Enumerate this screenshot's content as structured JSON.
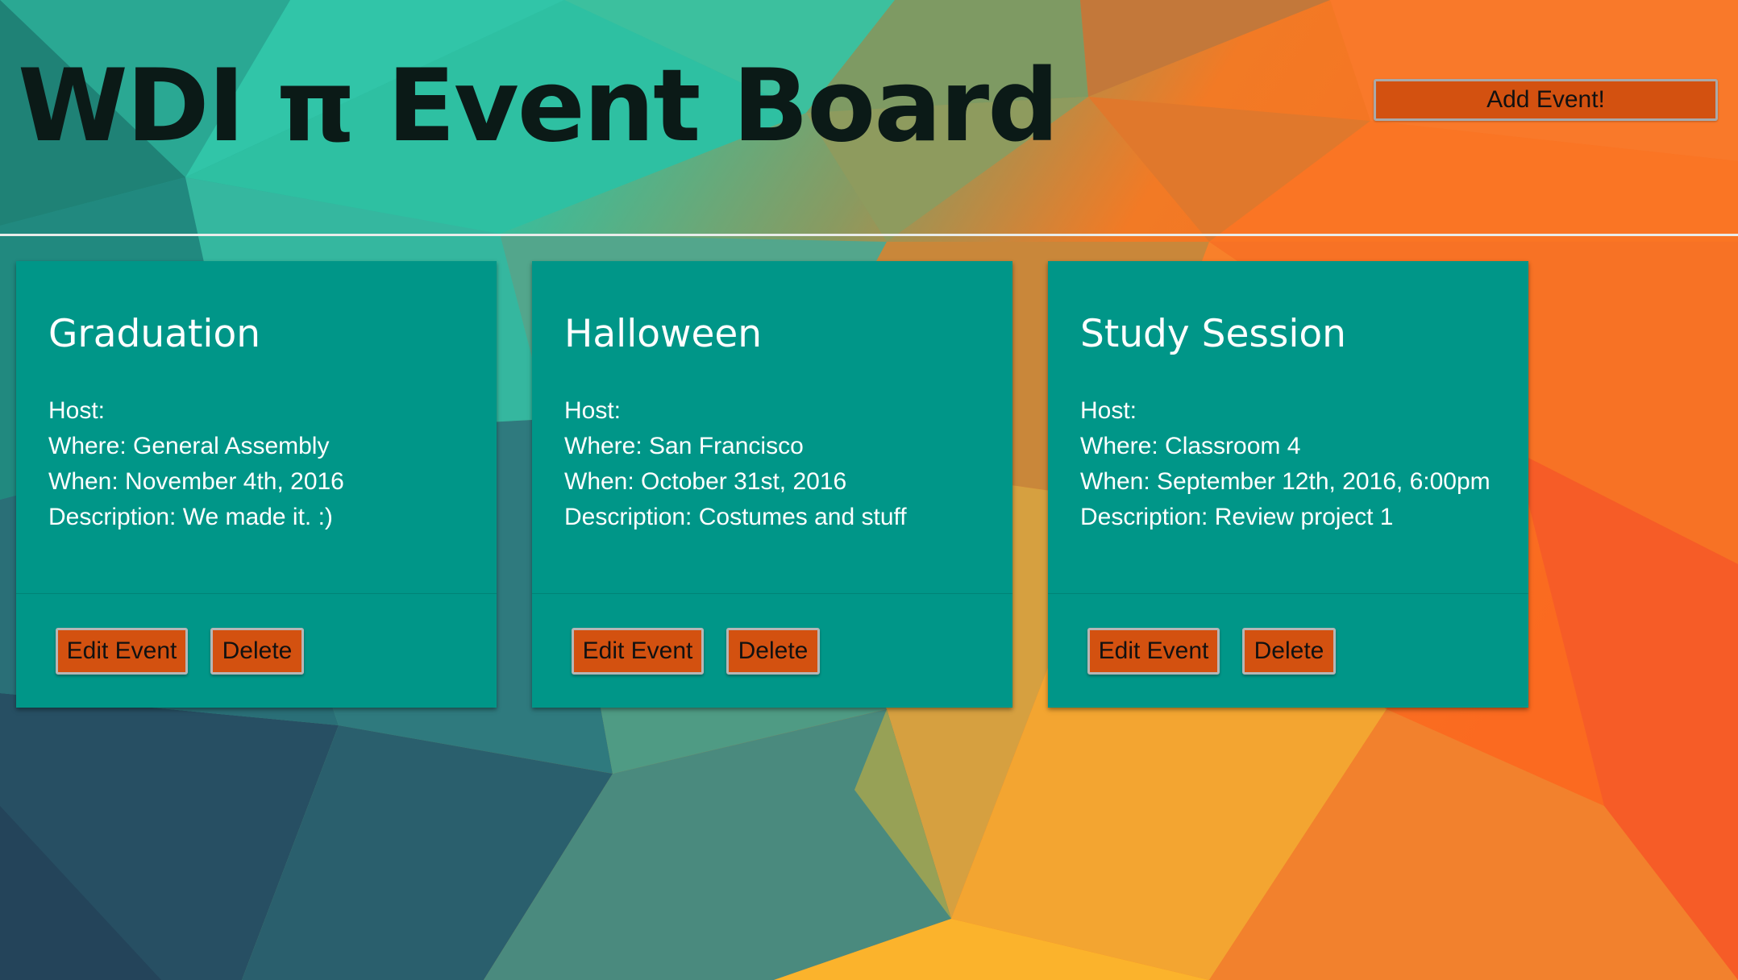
{
  "header": {
    "title": "WDI π Event Board",
    "add_button_label": "Add Event!"
  },
  "events": [
    {
      "title": "Graduation",
      "host": "Host:",
      "where": "Where: General Assembly",
      "when": "When: November 4th, 2016",
      "description": "Description: We made it. :)",
      "edit_label": "Edit Event",
      "delete_label": "Delete"
    },
    {
      "title": "Halloween",
      "host": "Host:",
      "where": "Where: San Francisco",
      "when": "When: October 31st, 2016",
      "description": "Description: Costumes and stuff",
      "edit_label": "Edit Event",
      "delete_label": "Delete"
    },
    {
      "title": "Study Session",
      "host": "Host:",
      "where": "Where: Classroom 4",
      "when": "When: September 12th, 2016, 6:00pm",
      "description": "Description: Review project 1",
      "edit_label": "Edit Event",
      "delete_label": "Delete"
    }
  ],
  "colors": {
    "card": "#009688",
    "button": "#d35110",
    "title_text": "#0b1a17"
  }
}
